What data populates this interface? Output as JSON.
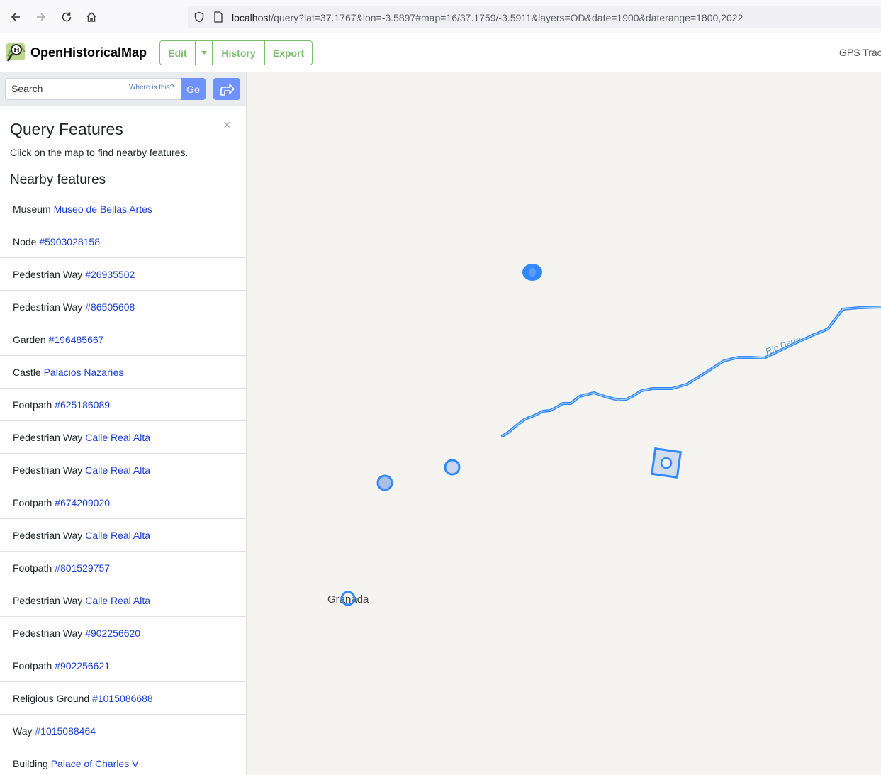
{
  "browser": {
    "url_host": "localhost",
    "url_rest": "/query?lat=37.1767&lon=-3.5897#map=16/37.1759/-3.5911&layers=OD&date=1900&daterange=1800,2022"
  },
  "header": {
    "brand": "OpenHistoricalMap",
    "edit_label": "Edit",
    "history_label": "History",
    "export_label": "Export",
    "gps_label": "GPS Trac"
  },
  "search": {
    "placeholder": "Search",
    "where_label": "Where is this?",
    "go_label": "Go"
  },
  "panel": {
    "title": "Query Features",
    "close": "×",
    "description": "Click on the map to find nearby features.",
    "nearby_title": "Nearby features",
    "features": [
      {
        "type": "Museum",
        "link": "Museo de Bellas Artes"
      },
      {
        "type": "Node",
        "link": "#5903028158"
      },
      {
        "type": "Pedestrian Way",
        "link": "#26935502"
      },
      {
        "type": "Pedestrian Way",
        "link": "#86505608"
      },
      {
        "type": "Garden",
        "link": "#196485667"
      },
      {
        "type": "Castle",
        "link": "Palacios Nazaríes"
      },
      {
        "type": "Footpath",
        "link": "#625186089"
      },
      {
        "type": "Pedestrian Way",
        "link": "Calle Real Alta"
      },
      {
        "type": "Pedestrian Way",
        "link": "Calle Real Alta"
      },
      {
        "type": "Footpath",
        "link": "#674209020"
      },
      {
        "type": "Pedestrian Way",
        "link": "Calle Real Alta"
      },
      {
        "type": "Footpath",
        "link": "#801529757"
      },
      {
        "type": "Pedestrian Way",
        "link": "Calle Real Alta"
      },
      {
        "type": "Pedestrian Way",
        "link": "#902256620"
      },
      {
        "type": "Footpath",
        "link": "#902256621"
      },
      {
        "type": "Religious Ground",
        "link": "#1015086688"
      },
      {
        "type": "Way",
        "link": "#1015088464"
      },
      {
        "type": "Building",
        "link": "Palace of Charles V"
      }
    ]
  },
  "map": {
    "river_label": "Río Darro",
    "city_label": "Granada",
    "highlight_color": "#3388ff",
    "background_color": "#f5f4f0"
  }
}
